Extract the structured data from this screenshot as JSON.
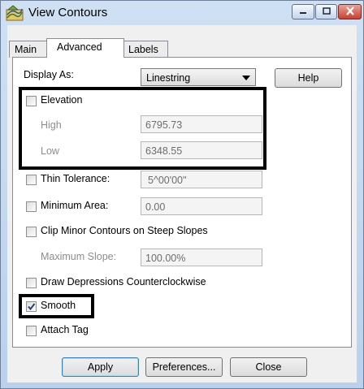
{
  "window": {
    "title": "View Contours"
  },
  "tabs": [
    {
      "label": "Main"
    },
    {
      "label": "Advanced"
    },
    {
      "label": "Labels"
    }
  ],
  "display_as": {
    "label": "Display As:",
    "value": "Linestring"
  },
  "help_button": "Help",
  "elevation": {
    "label": "Elevation",
    "checked": false,
    "high_label": "High",
    "high_value": "6795.73",
    "low_label": "Low",
    "low_value": "6348.55"
  },
  "thin_tolerance": {
    "label": "Thin Tolerance:",
    "value": "5^00'00\"",
    "checked": false
  },
  "minimum_area": {
    "label": "Minimum Area:",
    "value": "0.00",
    "checked": false
  },
  "clip_minor": {
    "label": "Clip Minor Contours on Steep Slopes",
    "checked": false
  },
  "maximum_slope": {
    "label": "Maximum Slope:",
    "value": "100.00%"
  },
  "draw_depressions": {
    "label": "Draw Depressions Counterclockwise",
    "checked": false
  },
  "smooth": {
    "label": "Smooth",
    "checked": true
  },
  "attach_tag": {
    "label": "Attach Tag",
    "checked": false
  },
  "buttons": {
    "apply": "Apply",
    "preferences": "Preferences...",
    "close": "Close"
  },
  "icons": {
    "app": "contour-app-icon",
    "minimize": "minimize-icon",
    "maximize": "maximize-icon",
    "close": "close-x-icon",
    "dropdown": "chevron-down-icon",
    "check": "checkmark-icon"
  }
}
